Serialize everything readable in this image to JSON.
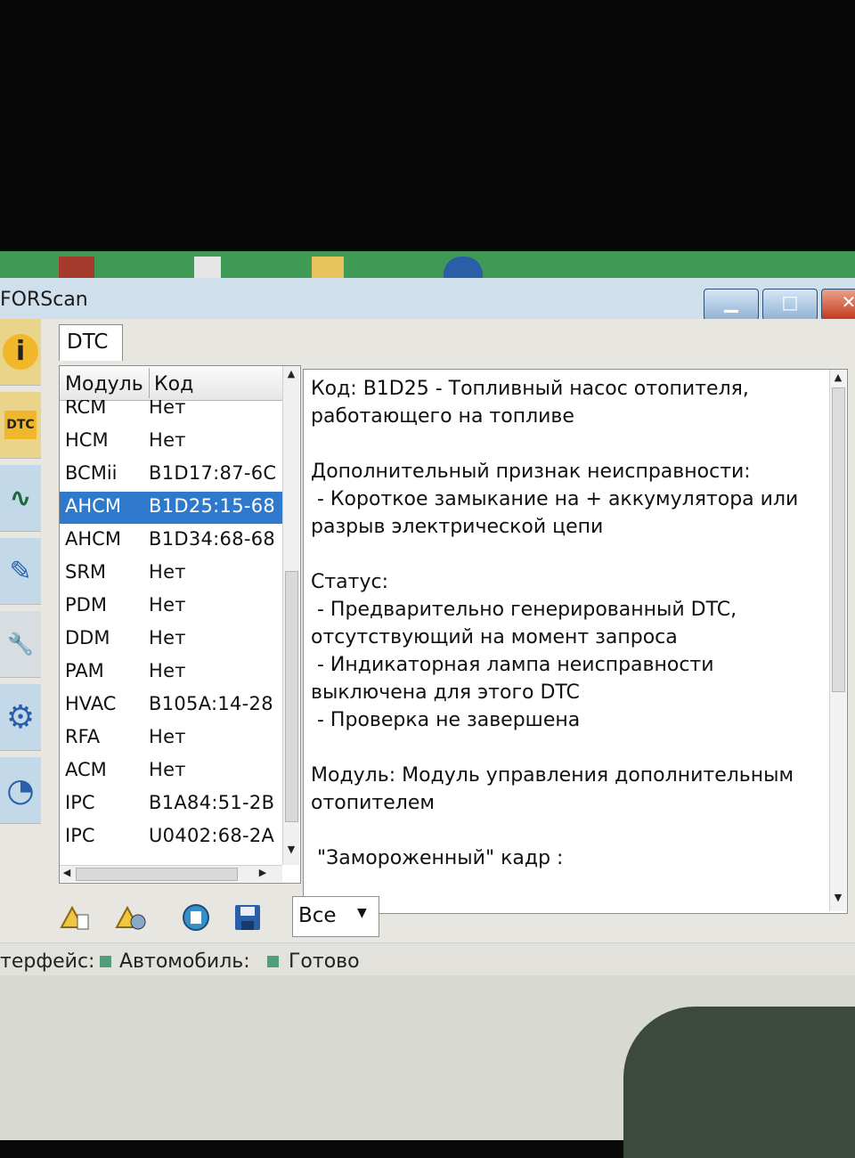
{
  "window": {
    "title": "FORScan",
    "controls": {
      "minimize": "▁",
      "maximize": "□",
      "close": "✕"
    }
  },
  "sidebar": {
    "items": [
      {
        "name": "info-icon",
        "glyph": "i"
      },
      {
        "name": "dtc-icon",
        "glyph": "DTC"
      },
      {
        "name": "oscilloscope-icon",
        "glyph": "∿"
      },
      {
        "name": "checklist-icon",
        "glyph": "✎"
      },
      {
        "name": "wrench-icon",
        "glyph": "🔧"
      },
      {
        "name": "gear-icon",
        "glyph": "⚙"
      },
      {
        "name": "gauge-icon",
        "glyph": "◔"
      }
    ]
  },
  "tabs": {
    "active": "DTC"
  },
  "dtc_list": {
    "headers": {
      "module": "Модуль",
      "code": "Код"
    },
    "rows": [
      {
        "module": "RCM",
        "code": "Нет",
        "selected": false
      },
      {
        "module": "HCM",
        "code": "Нет",
        "selected": false
      },
      {
        "module": "BCMii",
        "code": "B1D17:87-6C",
        "selected": false
      },
      {
        "module": "AHCM",
        "code": "B1D25:15-68",
        "selected": true
      },
      {
        "module": "AHCM",
        "code": "B1D34:68-68",
        "selected": false
      },
      {
        "module": "SRM",
        "code": "Нет",
        "selected": false
      },
      {
        "module": "PDM",
        "code": "Нет",
        "selected": false
      },
      {
        "module": "DDM",
        "code": "Нет",
        "selected": false
      },
      {
        "module": "PAM",
        "code": "Нет",
        "selected": false
      },
      {
        "module": "HVAC",
        "code": "B105A:14-28",
        "selected": false
      },
      {
        "module": "RFA",
        "code": "Нет",
        "selected": false
      },
      {
        "module": "ACM",
        "code": "Нет",
        "selected": false
      },
      {
        "module": "IPC",
        "code": "B1A84:51-2B",
        "selected": false
      },
      {
        "module": "IPC",
        "code": "U0402:68-2A",
        "selected": false
      }
    ]
  },
  "detail": {
    "text": "Код: B1D25 - Топливный насос отопителя,\nработающего на топливе\n\nДополнительный признак неисправности:\n - Короткое замыкание на + аккумулятора или\nразрыв электрической цепи\n\nСтатус:\n - Предварительно генерированный DTC,\nотсутствующий на момент запроса\n - Индикаторная лампа неисправности\nвыключена для этого DTC\n - Проверка не завершена\n\nМодуль: Модуль управления дополнительным\nотопителем\n\n \"Замороженный\" кадр :"
  },
  "toolbar": {
    "buttons": [
      "read-dtc-icon",
      "read-freeze-icon",
      "clear-dtc-icon",
      "save-icon"
    ],
    "filter": {
      "value": "Все"
    }
  },
  "status": {
    "interface_label": "терфейс:",
    "vehicle_label": "Автомобиль:",
    "state": "Готово",
    "led_color": "#4f9d7a"
  },
  "colors": {
    "selection": "#2f79cc",
    "desktop": "#3f9a56"
  }
}
